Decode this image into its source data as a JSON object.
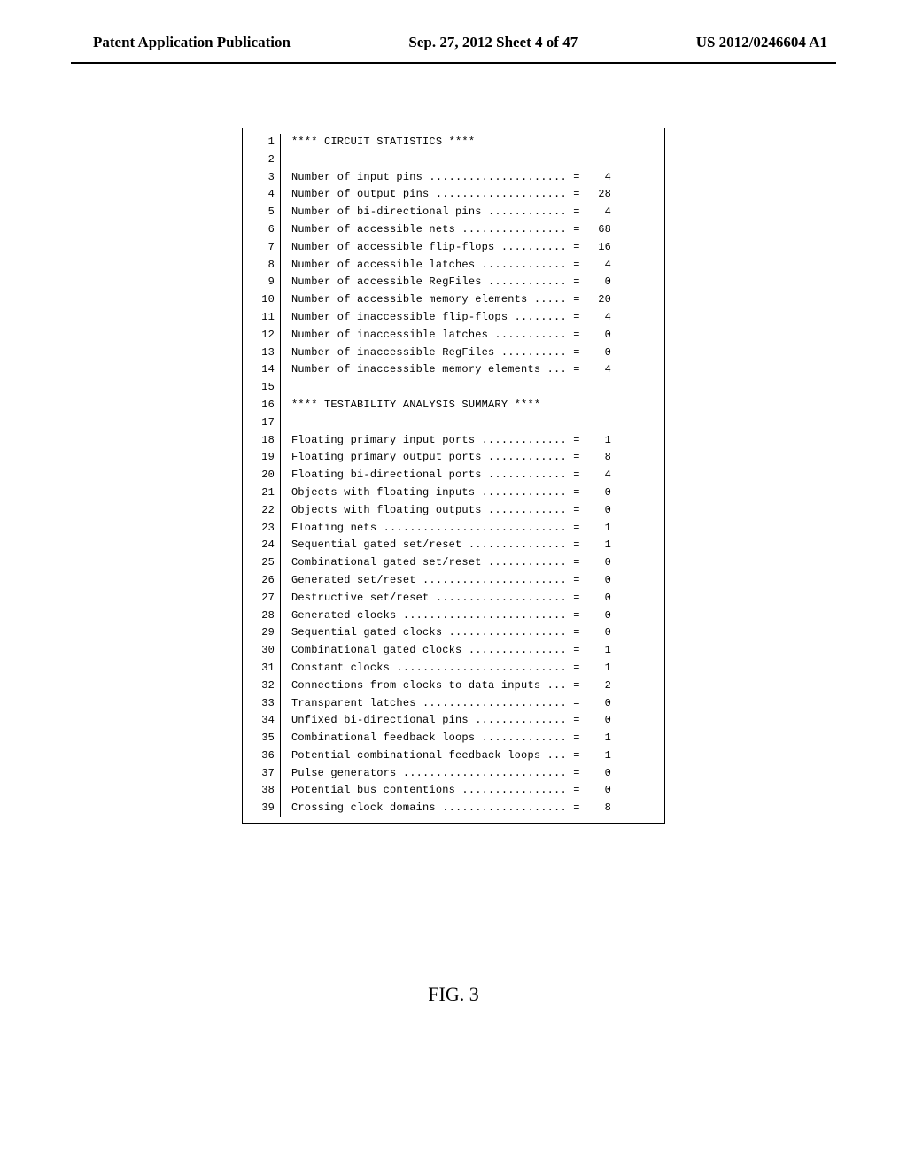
{
  "header": {
    "left": "Patent Application Publication",
    "center": "Sep. 27, 2012  Sheet 4 of 47",
    "right": "US 2012/0246604 A1"
  },
  "section1_title": "**** CIRCUIT STATISTICS ****",
  "section2_title": "**** TESTABILITY ANALYSIS SUMMARY ****",
  "stats1": [
    {
      "label": "Number of input pins",
      "value": "4"
    },
    {
      "label": "Number of output pins",
      "value": "28"
    },
    {
      "label": "Number of bi-directional pins",
      "value": "4"
    },
    {
      "label": "Number of accessible nets",
      "value": "68"
    },
    {
      "label": "Number of accessible flip-flops",
      "value": "16"
    },
    {
      "label": "Number of accessible latches",
      "value": "4"
    },
    {
      "label": "Number of accessible RegFiles",
      "value": "0"
    },
    {
      "label": "Number of accessible memory elements",
      "value": "20"
    },
    {
      "label": "Number of inaccessible flip-flops",
      "value": "4"
    },
    {
      "label": "Number of inaccessible latches",
      "value": "0"
    },
    {
      "label": "Number of inaccessible RegFiles",
      "value": "0"
    },
    {
      "label": "Number of inaccessible memory elements",
      "value": "4"
    }
  ],
  "stats2": [
    {
      "label": "Floating primary input ports",
      "value": "1"
    },
    {
      "label": "Floating primary output ports",
      "value": "8"
    },
    {
      "label": "Floating bi-directional ports",
      "value": "4"
    },
    {
      "label": "Objects with floating inputs",
      "value": "0"
    },
    {
      "label": "Objects with floating outputs",
      "value": "0"
    },
    {
      "label": "Floating nets",
      "value": "1"
    },
    {
      "label": "Sequential gated set/reset",
      "value": "1"
    },
    {
      "label": "Combinational gated set/reset",
      "value": "0"
    },
    {
      "label": "Generated set/reset",
      "value": "0"
    },
    {
      "label": "Destructive set/reset",
      "value": "0"
    },
    {
      "label": "Generated clocks",
      "value": "0"
    },
    {
      "label": "Sequential gated clocks",
      "value": "0"
    },
    {
      "label": "Combinational gated clocks",
      "value": "1"
    },
    {
      "label": "Constant clocks",
      "value": "1"
    },
    {
      "label": "Connections from clocks to data inputs",
      "value": "2"
    },
    {
      "label": "Transparent latches",
      "value": "0"
    },
    {
      "label": "Unfixed bi-directional pins",
      "value": "0"
    },
    {
      "label": "Combinational feedback loops",
      "value": "1"
    },
    {
      "label": "Potential combinational feedback loops",
      "value": "1"
    },
    {
      "label": "Pulse generators",
      "value": "0"
    },
    {
      "label": "Potential bus contentions",
      "value": "0"
    },
    {
      "label": "Crossing clock domains",
      "value": "8"
    }
  ],
  "figure_caption": "FIG. 3"
}
